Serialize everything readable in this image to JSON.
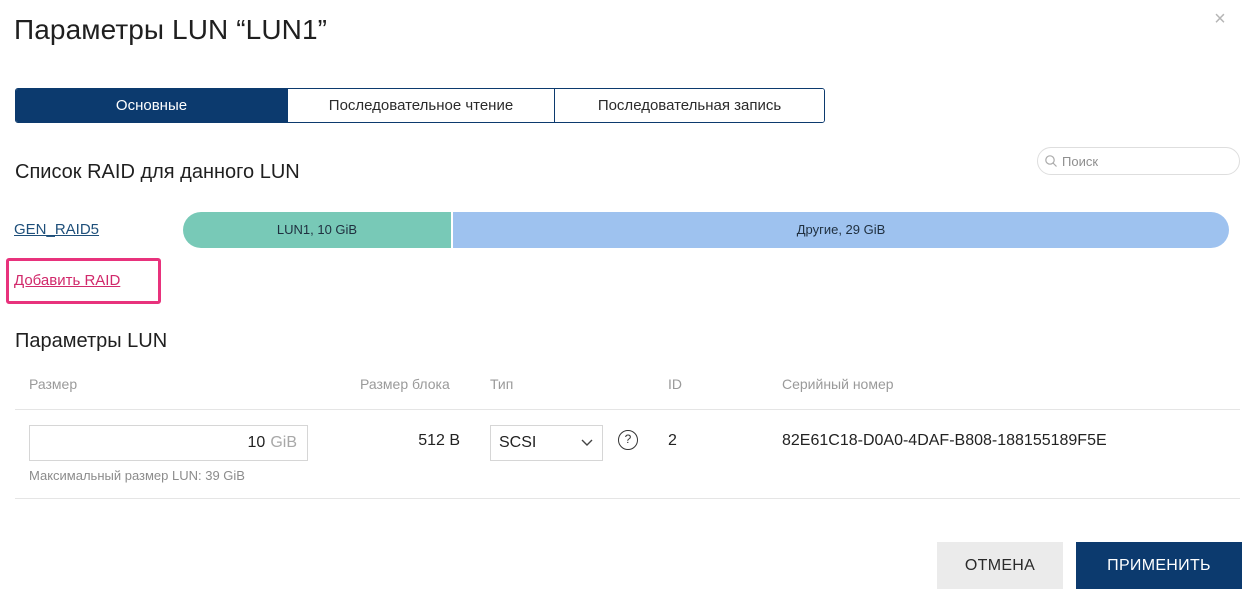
{
  "dialog": {
    "title": "Параметры LUN “LUN1”",
    "close_glyph": "×"
  },
  "tabs": [
    {
      "label": "Основные",
      "active": true
    },
    {
      "label": "Последовательное чтение",
      "active": false
    },
    {
      "label": "Последовательная запись",
      "active": false
    }
  ],
  "raid_section": {
    "title": "Список RAID для данного LUN",
    "search_placeholder": "Поиск",
    "raids": [
      {
        "name": "GEN_RAID5",
        "segments": [
          {
            "label": "LUN1, 10 GiB",
            "color": "#78c9b7"
          },
          {
            "label": "Другие, 29 GiB",
            "color": "#9ec2ef"
          }
        ]
      }
    ],
    "add_raid_label": "Добавить RAID"
  },
  "params_section": {
    "title": "Параметры LUN",
    "headers": {
      "size": "Размер",
      "block_size": "Размер блока",
      "type": "Тип",
      "id": "ID",
      "serial": "Серийный номер"
    },
    "row": {
      "size_value": "10",
      "size_unit": "GiB",
      "max_size_note": "Максимальный размер LUN: 39 GiB",
      "block_size": "512 B",
      "type": "SCSI",
      "help_glyph": "?",
      "id": "2",
      "serial": "82E61C18-D0A0-4DAF-B808-188155189F5E"
    }
  },
  "buttons": {
    "cancel": "ОТМЕНА",
    "apply": "ПРИМЕНИТЬ"
  },
  "colors": {
    "primary": "#0c3a6e",
    "highlight": "#e8327c",
    "link": "#1e4f7a"
  }
}
